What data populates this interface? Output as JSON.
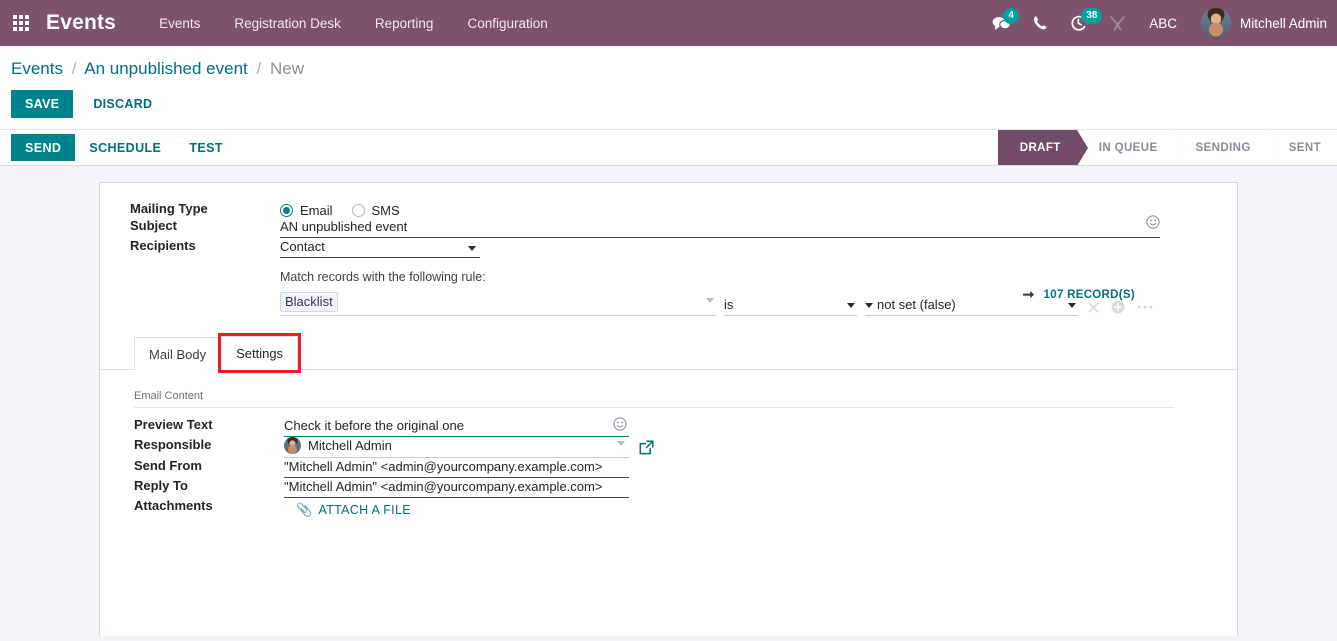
{
  "navbar": {
    "apps_icon": "apps-grid-icon",
    "brand": "Events",
    "menu": [
      {
        "label": "Events"
      },
      {
        "label": "Registration Desk"
      },
      {
        "label": "Reporting"
      },
      {
        "label": "Configuration"
      }
    ],
    "messages_icon": "messages-icon",
    "messages_count": "4",
    "phone_icon": "phone-icon",
    "activity_icon": "activity-clock-icon",
    "activity_count": "38",
    "tools_icon": "tools-icon",
    "debug_label": "ABC",
    "user": "Mitchell Admin",
    "brand_color": "#7c526d",
    "badge_color": "#00a09d"
  },
  "breadcrumb": {
    "root": "Events",
    "parent": "An unpublished event",
    "current": "New",
    "separator": "/"
  },
  "actions": {
    "save_label": "SAVE",
    "discard_label": "DISCARD",
    "save_color": "#00838a"
  },
  "control_bar": {
    "send_label": "SEND",
    "schedule_label": "SCHEDULE",
    "test_label": "TEST",
    "status_steps": [
      {
        "label": "DRAFT",
        "active": true
      },
      {
        "label": "IN QUEUE",
        "active": false
      },
      {
        "label": "SENDING",
        "active": false
      },
      {
        "label": "SENT",
        "active": false
      }
    ],
    "active_color": "#714b67"
  },
  "form": {
    "mailing_type_label": "Mailing Type",
    "mailing_type_options": [
      {
        "label": "Email",
        "selected": true
      },
      {
        "label": "SMS",
        "selected": false
      }
    ],
    "subject_label": "Subject",
    "subject_value": "AN unpublished event",
    "subject_emoji_icon": "smiley-icon",
    "recipients_label": "Recipients",
    "recipients_value": "Contact",
    "rule_note": "Match records with the following rule:",
    "rule_field": "Blacklist",
    "rule_operator": "is",
    "rule_value": "not set (false)",
    "record_count": "107 RECORD(S)",
    "record_arrow_icon": "arrow-right-icon",
    "rule_remove_icon": "close-icon",
    "rule_add_icon": "plus-circle-icon",
    "rule_more_icon": "ellipsis-icon"
  },
  "notebook": {
    "tabs": [
      {
        "label": "Mail Body",
        "active": false,
        "highlighted": false
      },
      {
        "label": "Settings",
        "active": true,
        "highlighted": true
      }
    ],
    "highlight_color": "#ee1b24"
  },
  "settings": {
    "section_title": "Email Content",
    "preview_label": "Preview Text",
    "preview_value": "Check it before the original one",
    "preview_emoji_icon": "smiley-icon",
    "responsible_label": "Responsible",
    "responsible_value": "Mitchell Admin",
    "responsible_avatar": "avatar",
    "responsible_external_icon": "external-link-icon",
    "send_from_label": "Send From",
    "send_from_value": "\"Mitchell Admin\" <admin@yourcompany.example.com>",
    "reply_to_label": "Reply To",
    "reply_to_value": "\"Mitchell Admin\" <admin@yourcompany.example.com>",
    "attachments_label": "Attachments",
    "attach_button_label": "ATTACH A FILE",
    "attach_icon": "paperclip-icon"
  }
}
